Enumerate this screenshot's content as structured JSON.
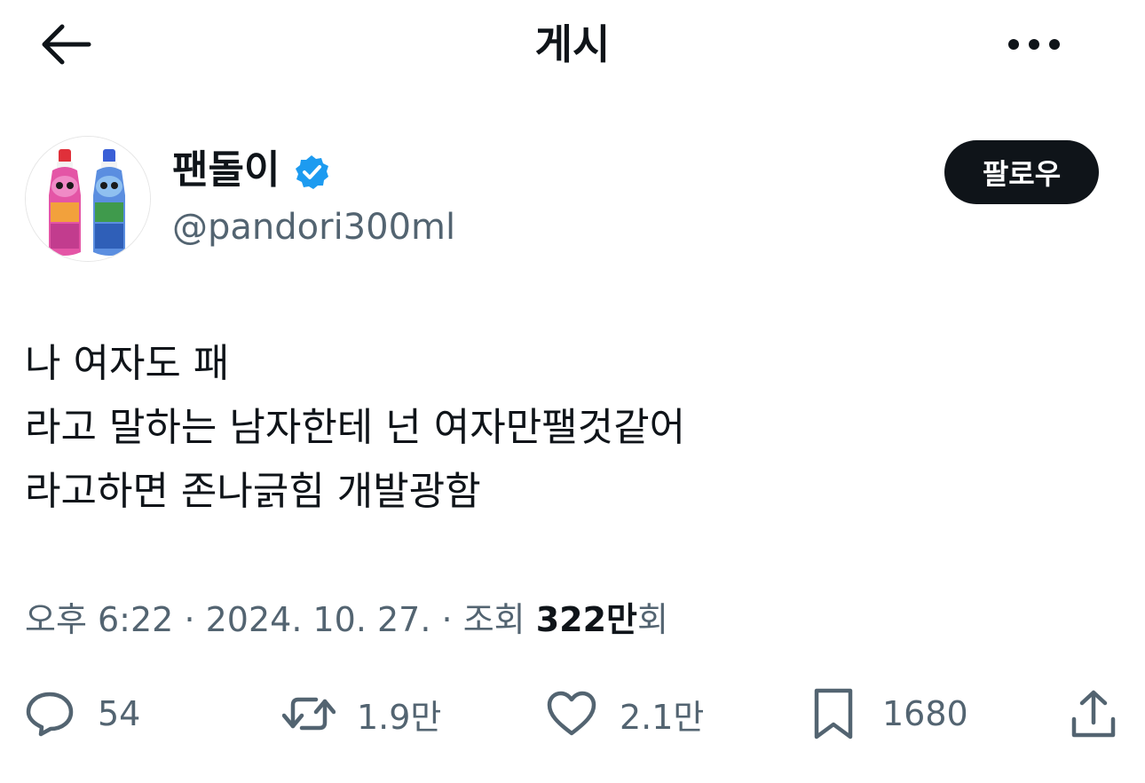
{
  "header": {
    "title": "게시"
  },
  "author": {
    "display_name": "팬돌이",
    "handle": "@pandori300ml",
    "verified": true,
    "follow_label": "팔로우"
  },
  "tweet": {
    "lines": [
      "나 여자도 패",
      "라고 말하는 남자한테 넌 여자만팰것같어",
      "라고하면 존나긁힘 개발광함"
    ]
  },
  "meta": {
    "time": "오후 6:22",
    "date": "2024. 10. 27.",
    "views_label": "조회",
    "views_value": "322만",
    "views_suffix": "회",
    "separator": "·"
  },
  "actions": {
    "replies": "54",
    "reposts": "1.9만",
    "likes": "2.1만",
    "bookmarks": "1680"
  },
  "colors": {
    "text": "#0f1419",
    "secondary": "#536471",
    "verified": "#1d9bf0",
    "follow_bg": "#0f1419"
  }
}
